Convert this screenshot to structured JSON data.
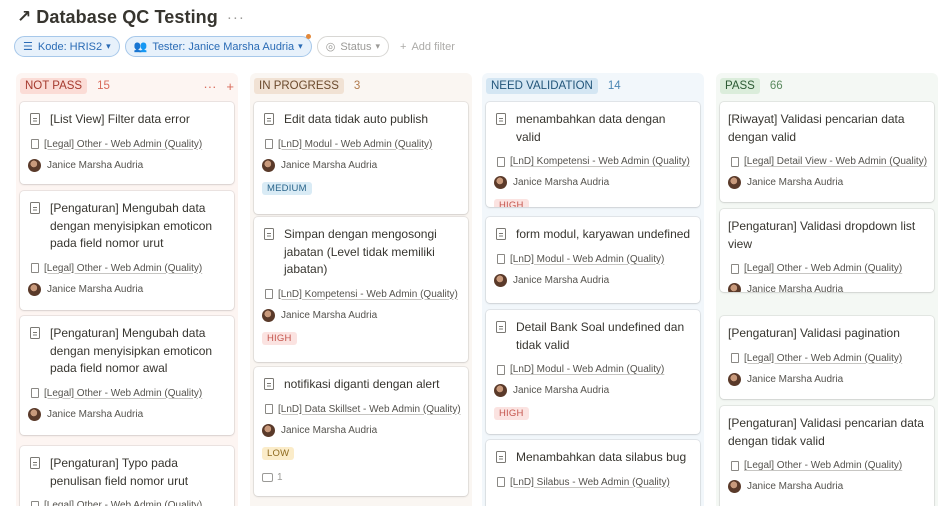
{
  "title": {
    "arrow": "↗",
    "text": "Database QC Testing",
    "more": "···"
  },
  "filters": {
    "kode_label": "Kode: HRIS2",
    "tester_label": "Tester: Janice Marsha Audria",
    "status_label": "Status",
    "add_filter_label": "Add filter"
  },
  "columns": [
    {
      "name": "NOT PASS",
      "count": "15",
      "colors": {
        "bg": "#fdf5f2",
        "pill_bg": "#fbdcd6",
        "pill_text": "#a53a2e",
        "count": "#d96a5a"
      },
      "tools": {
        "more": "···",
        "add": "+"
      },
      "cards": [
        {
          "title": "[List View] Filter data error",
          "relation": "[Legal] Other - Web Admin (Quality)",
          "person": "Janice Marsha Audria",
          "priority": "",
          "comments": ""
        },
        {
          "title": "[Pengaturan] Mengubah data dengan menyisipkan emoticon pada field nomor urut",
          "relation": "[Legal] Other - Web Admin (Quality)",
          "person": "Janice Marsha Audria",
          "priority": "",
          "comments": ""
        },
        {
          "title": "[Pengaturan] Mengubah data dengan menyisipkan emoticon pada field nomor awal",
          "relation": "[Legal] Other - Web Admin (Quality)",
          "person": "Janice Marsha Audria",
          "priority": "",
          "comments": ""
        },
        {
          "title": "[Pengaturan] Typo pada penulisan field nomor urut",
          "relation": "[Legal] Other - Web Admin (Quality)",
          "person": "",
          "priority": "",
          "comments": ""
        }
      ]
    },
    {
      "name": "IN PROGRESS",
      "count": "3",
      "colors": {
        "bg": "#faf6f2",
        "pill_bg": "#f1e2d4",
        "pill_text": "#6b4a2d",
        "count": "#b07a4c"
      },
      "tools": {
        "more": "",
        "add": ""
      },
      "cards": [
        {
          "title": "Edit data tidak auto publish",
          "relation": "[LnD] Modul - Web Admin (Quality)",
          "person": "Janice Marsha Audria",
          "priority": "MEDIUM",
          "comments": ""
        },
        {
          "title": "Simpan dengan mengosongi jabatan (Level tidak memiliki jabatan)",
          "relation": "[LnD] Kompetensi - Web Admin (Quality)",
          "person": "Janice Marsha Audria",
          "priority": "HIGH",
          "comments": ""
        },
        {
          "title": "notifikasi diganti dengan alert",
          "relation": "[LnD] Data Skillset - Web Admin (Quality)",
          "person": "Janice Marsha Audria",
          "priority": "LOW",
          "comments": "1"
        }
      ]
    },
    {
      "name": "NEED VALIDATION",
      "count": "14",
      "colors": {
        "bg": "#f2f7fb",
        "pill_bg": "#d4e6f3",
        "pill_text": "#22557a",
        "count": "#4b86b3"
      },
      "tools": {
        "more": "",
        "add": ""
      },
      "cards": [
        {
          "title": "menambahkan data dengan valid",
          "relation": "[LnD] Kompetensi - Web Admin (Quality)",
          "person": "Janice Marsha Audria",
          "priority": "HIGH",
          "comments": ""
        },
        {
          "title": "form modul, karyawan undefined",
          "relation": "[LnD] Modul - Web Admin (Quality)",
          "person": "Janice Marsha Audria",
          "priority": "",
          "comments": ""
        },
        {
          "title": "Detail Bank Soal undefined dan tidak valid",
          "relation": "[LnD] Modul - Web Admin (Quality)",
          "person": "Janice Marsha Audria",
          "priority": "HIGH",
          "comments": ""
        },
        {
          "title": "Menambahkan data silabus bug",
          "relation": "[LnD] Silabus - Web Admin (Quality)",
          "person": "",
          "priority": "",
          "comments": ""
        }
      ]
    },
    {
      "name": "PASS",
      "count": "66",
      "colors": {
        "bg": "#f4f8f4",
        "pill_bg": "#dbeddb",
        "pill_text": "#2b5a33",
        "count": "#5b8a5f"
      },
      "tools": {
        "more": "",
        "add": ""
      },
      "cards": [
        {
          "title": "[Riwayat] Validasi pencarian data dengan valid",
          "relation": "[Legal] Detail View - Web Admin (Quality)",
          "person": "Janice Marsha Audria",
          "priority": "",
          "comments": ""
        },
        {
          "title": "[Pengaturan] Validasi dropdown list view",
          "relation": "[Legal] Other - Web Admin (Quality)",
          "person": "Janice Marsha Audria",
          "priority": "",
          "comments": ""
        },
        {
          "title": "[Pengaturan] Validasi pagination",
          "relation": "[Legal] Other - Web Admin (Quality)",
          "person": "Janice Marsha Audria",
          "priority": "",
          "comments": ""
        },
        {
          "title": "[Pengaturan] Validasi pencarian data dengan tidak valid",
          "relation": "[Legal] Other - Web Admin (Quality)",
          "person": "Janice Marsha Audria",
          "priority": "",
          "comments": ""
        }
      ]
    }
  ]
}
